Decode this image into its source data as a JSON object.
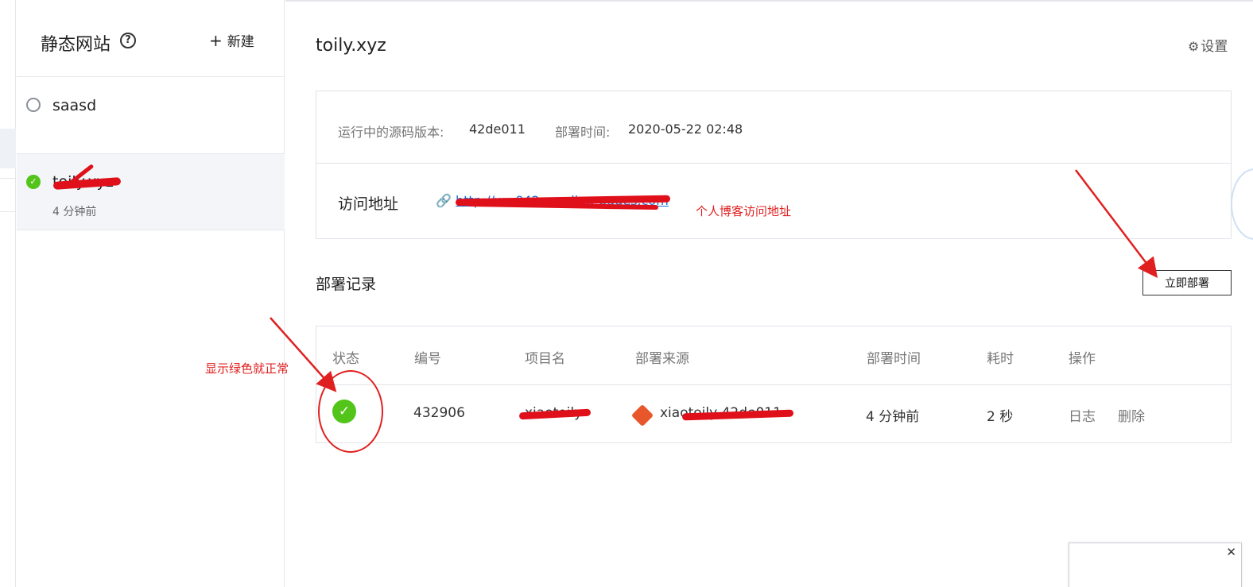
{
  "sidebar": {
    "title": "静态网站",
    "new_label": "新建",
    "sites": [
      {
        "name": "saasd",
        "time": ""
      },
      {
        "name": "toily.xyz",
        "time": "4 分钟前"
      }
    ]
  },
  "main": {
    "title": "toily.xyz",
    "settings_label": "设置",
    "source_version_label": "运行中的源码版本:",
    "source_version": "42de011",
    "deploy_time_label": "部署时间:",
    "deploy_time": "2020-05-22 02:48",
    "visit_label": "访问地址",
    "visit_url": "http://ww042q.coding-pages.com",
    "section_title": "部署记录",
    "deploy_now": "立即部署"
  },
  "table": {
    "headers": [
      "状态",
      "编号",
      "项目名",
      "部署来源",
      "部署时间",
      "耗时",
      "操作"
    ],
    "row": {
      "id": "432906",
      "project": "xiaotoily",
      "source": "xiaotoily 42de011",
      "time": "4 分钟前",
      "duration": "2 秒",
      "op_log": "日志",
      "op_delete": "删除"
    }
  },
  "annotations": {
    "blog_url_note": "个人博客访问地址",
    "green_note": "显示绿色就正常"
  },
  "colors": {
    "success": "#52c41a",
    "link": "#1a6dd6",
    "annotation": "#e02020",
    "git": "#e8572b"
  },
  "icons": {
    "help": "help-circle-icon",
    "settings": "gear-icon",
    "link": "link-icon",
    "git": "git-icon",
    "close": "close-icon"
  }
}
